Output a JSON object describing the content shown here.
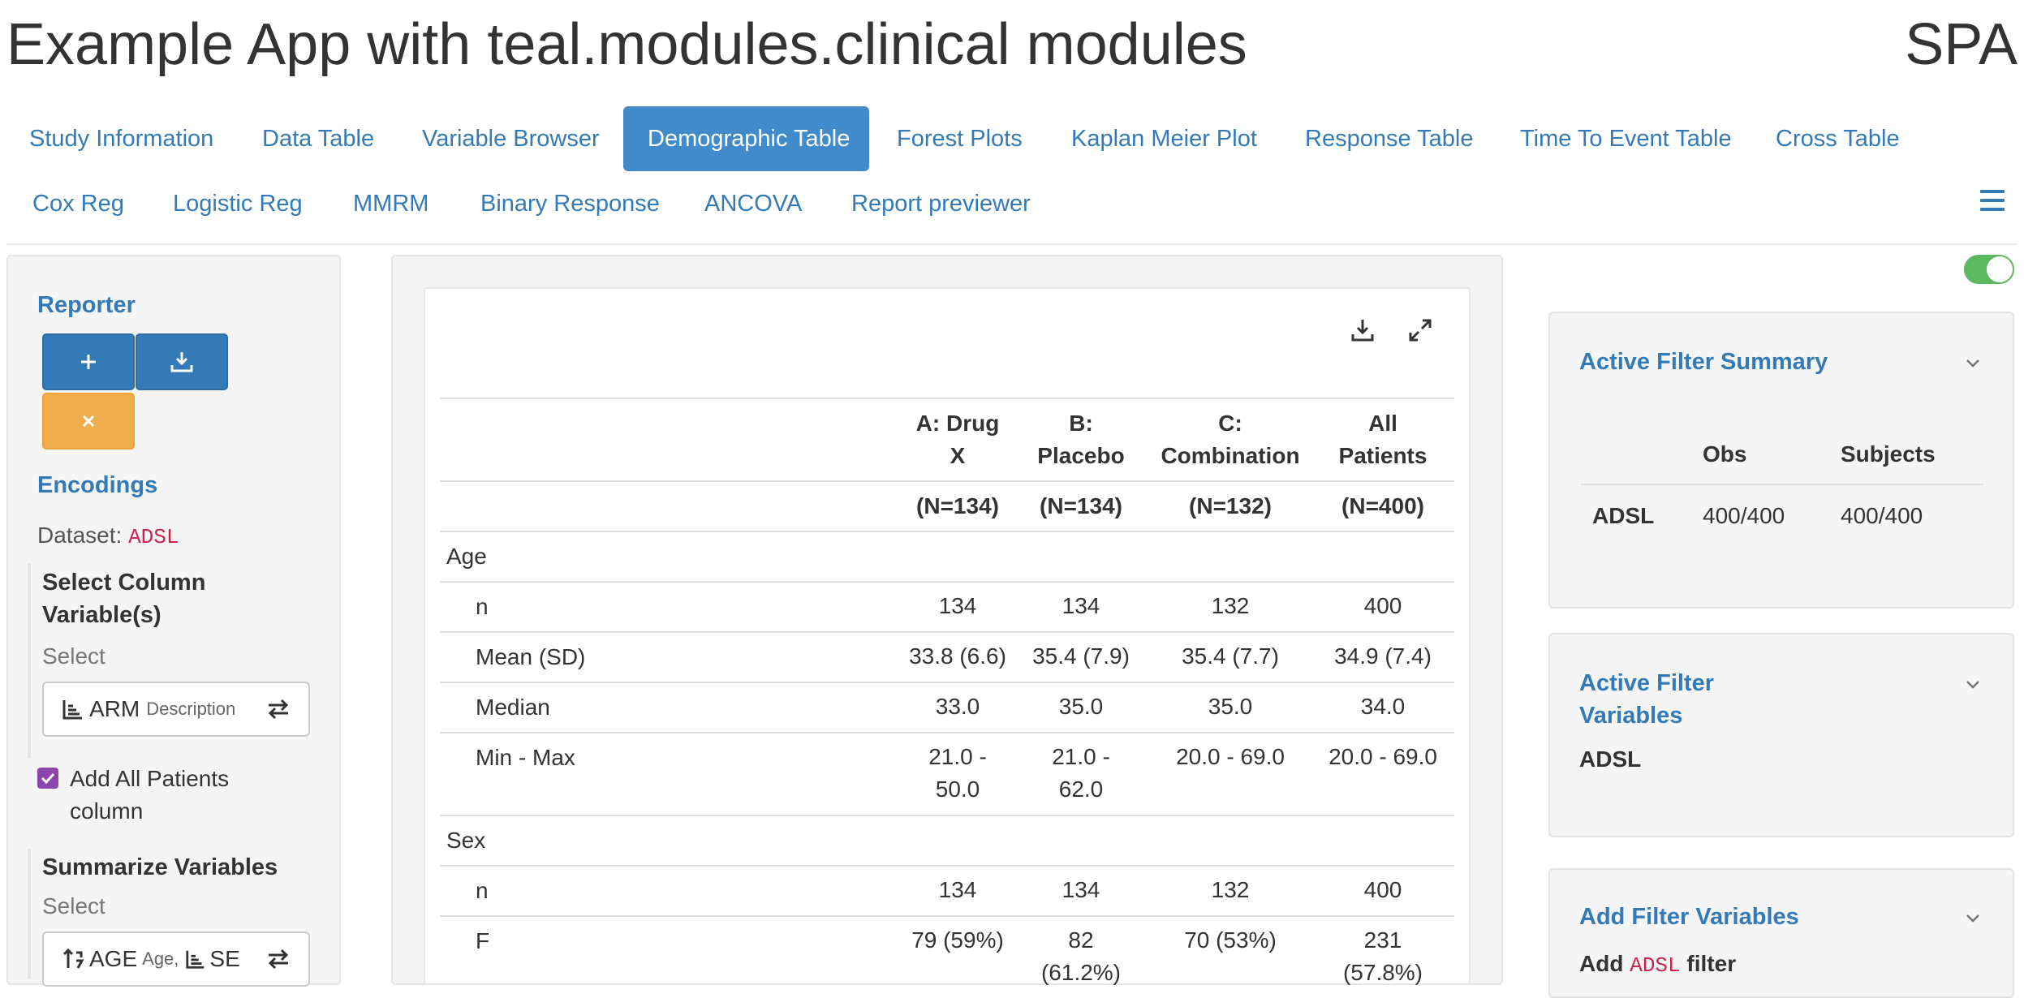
{
  "app": {
    "title": "Example App with teal.modules.clinical modules",
    "corner_label": "SPA"
  },
  "nav": {
    "tabs_row1": [
      "Study Information",
      "Data Table",
      "Variable Browser",
      "Demographic Table",
      "Forest Plots",
      "Kaplan Meier Plot",
      "Response Table",
      "Time To Event Table",
      "Cross Table"
    ],
    "tabs_row2": [
      "Cox Reg",
      "Logistic Reg",
      "MMRM",
      "Binary Response",
      "ANCOVA",
      "Report previewer"
    ],
    "active_tab": "Demographic Table",
    "menu_icon": "hamburger-icon"
  },
  "left": {
    "reporter_label": "Reporter",
    "reporter_buttons": [
      "plus-icon",
      "download-icon",
      "close-icon"
    ],
    "encodings_label": "Encodings",
    "dataset_label": "Dataset:",
    "dataset_value": "ADSL",
    "column_vars_label": "Select Column Variable(s)",
    "column_vars_hint": "Select",
    "column_vars_value": "ARM",
    "column_vars_desc": "Description",
    "add_all_patients_label": "Add All Patients column",
    "add_all_patients_checked": true,
    "summarize_label": "Summarize Variables",
    "summarize_hint": "Select",
    "summarize_value1": "AGE",
    "summarize_value1_desc": "Age,",
    "summarize_value2": "SE"
  },
  "table": {
    "icons": [
      "download-icon",
      "expand-icon"
    ],
    "columns": [
      {
        "line1": "A: Drug",
        "line2": "X",
        "n": "(N=134)"
      },
      {
        "line1": "B:",
        "line2": "Placebo",
        "n": "(N=134)"
      },
      {
        "line1": "C:",
        "line2": "Combination",
        "n": "(N=132)"
      },
      {
        "line1": "All",
        "line2": "Patients",
        "n": "(N=400)"
      }
    ],
    "groups": [
      {
        "name": "Age",
        "rows": [
          {
            "label": "n",
            "cells": [
              [
                "134"
              ],
              [
                "134"
              ],
              [
                "132"
              ],
              [
                "400"
              ]
            ]
          },
          {
            "label": "Mean (SD)",
            "cells": [
              [
                "33.8 (6.6)"
              ],
              [
                "35.4 (7.9)"
              ],
              [
                "35.4 (7.7)"
              ],
              [
                "34.9 (7.4)"
              ]
            ]
          },
          {
            "label": "Median",
            "cells": [
              [
                "33.0"
              ],
              [
                "35.0"
              ],
              [
                "35.0"
              ],
              [
                "34.0"
              ]
            ]
          },
          {
            "label": "Min - Max",
            "cells": [
              [
                "21.0 -",
                "50.0"
              ],
              [
                "21.0 -",
                "62.0"
              ],
              [
                "20.0 - 69.0"
              ],
              [
                "20.0 - 69.0"
              ]
            ]
          }
        ]
      },
      {
        "name": "Sex",
        "rows": [
          {
            "label": "n",
            "cells": [
              [
                "134"
              ],
              [
                "134"
              ],
              [
                "132"
              ],
              [
                "400"
              ]
            ]
          },
          {
            "label": "F",
            "cells": [
              [
                "79 (59%)"
              ],
              [
                "82",
                "(61.2%)"
              ],
              [
                "70 (53%)"
              ],
              [
                "231",
                "(57.8%)"
              ]
            ]
          }
        ]
      }
    ]
  },
  "right": {
    "toggle_on": true,
    "summary": {
      "title": "Active Filter Summary",
      "headers": [
        "",
        "Obs",
        "Subjects"
      ],
      "rows": [
        {
          "name": "ADSL",
          "obs": "400/400",
          "subjects": "400/400"
        }
      ]
    },
    "active_vars": {
      "title_line1": "Active Filter",
      "title_line2": "Variables",
      "dataset": "ADSL"
    },
    "add_filter": {
      "title": "Add Filter Variables",
      "prefix": "Add",
      "dataset": "ADSL",
      "suffix": "filter"
    }
  },
  "colors": {
    "accent": "#337ab7",
    "active_tab": "#428bca",
    "warn": "#f0ad4e",
    "code": "#c7254e",
    "toggle": "#5cb85c"
  }
}
